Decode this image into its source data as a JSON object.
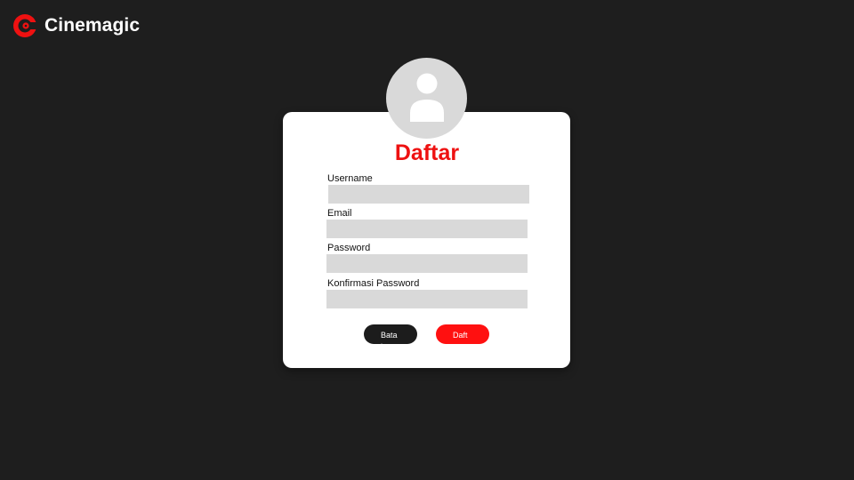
{
  "brand": {
    "name": "Cinemagic",
    "logo_icon": "cinemagic-logo-icon",
    "color": "#ee1111"
  },
  "form": {
    "title": "Daftar",
    "avatar_icon": "user-avatar-icon",
    "fields": [
      {
        "label": "Username",
        "value": "",
        "placeholder": ""
      },
      {
        "label": "Email",
        "value": "",
        "placeholder": ""
      },
      {
        "label": "Password",
        "value": "",
        "placeholder": ""
      },
      {
        "label": "Konfirmasi Password",
        "value": "",
        "placeholder": ""
      }
    ],
    "cancel_label": "Batal",
    "submit_label": "Daftar"
  },
  "colors": {
    "background": "#1e1e1e",
    "card": "#ffffff",
    "accent": "#ee1111",
    "input": "#d9d9d9",
    "cancel_button": "#1c1c1c"
  }
}
